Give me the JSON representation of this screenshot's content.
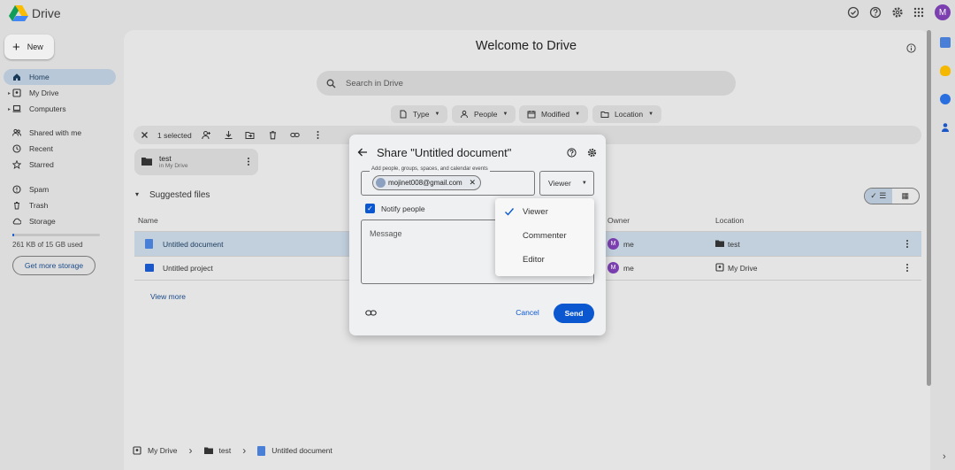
{
  "app": {
    "title": "Drive",
    "avatar_letter": "M"
  },
  "sidebar": {
    "new_label": "New",
    "items": [
      {
        "label": "Home",
        "icon": "home-icon",
        "active": true
      },
      {
        "label": "My Drive",
        "icon": "my-drive-icon"
      },
      {
        "label": "Computers",
        "icon": "computers-icon"
      },
      {
        "label": "Shared with me",
        "icon": "shared-icon"
      },
      {
        "label": "Recent",
        "icon": "clock-icon"
      },
      {
        "label": "Starred",
        "icon": "star-icon"
      },
      {
        "label": "Spam",
        "icon": "spam-icon"
      },
      {
        "label": "Trash",
        "icon": "trash-icon"
      },
      {
        "label": "Storage",
        "icon": "cloud-icon"
      }
    ],
    "storage_text": "261 KB of 15 GB used",
    "storage_fraction": 1.74e-05,
    "storage_button": "Get more storage"
  },
  "main": {
    "welcome": "Welcome to Drive",
    "search_placeholder": "Search in Drive",
    "filters": [
      "Type",
      "People",
      "Modified",
      "Location"
    ],
    "selection": {
      "count_label": "1 selected"
    },
    "folder": {
      "name": "test",
      "location": "in My Drive"
    },
    "suggested_title": "Suggested files",
    "columns": {
      "name": "Name",
      "owner": "Owner",
      "location": "Location"
    },
    "rows": [
      {
        "name": "Untitled document",
        "owner": "me",
        "owner_initial": "M",
        "location": "test",
        "selected": true
      },
      {
        "name": "Untitled project",
        "owner": "me",
        "owner_initial": "M",
        "location": "My Drive",
        "selected": false
      }
    ],
    "view_more": "View more",
    "breadcrumbs": [
      "My Drive",
      "test",
      "Untitled document"
    ]
  },
  "share_dialog": {
    "title": "Share \"Untitled document\"",
    "people_label": "Add people, groups, spaces, and calendar events",
    "email_chip": "mojinet008@gmail.com",
    "role_value": "Viewer",
    "notify_label": "Notify people",
    "notify_checked": true,
    "message_placeholder": "Message",
    "cancel_label": "Cancel",
    "send_label": "Send",
    "role_menu": {
      "items": [
        "Viewer",
        "Commenter",
        "Editor"
      ],
      "selected": "Viewer"
    }
  },
  "colors": {
    "accent": "#0b57d0",
    "avatar": "#7b3fb0",
    "selected_row": "#c2d0de"
  }
}
